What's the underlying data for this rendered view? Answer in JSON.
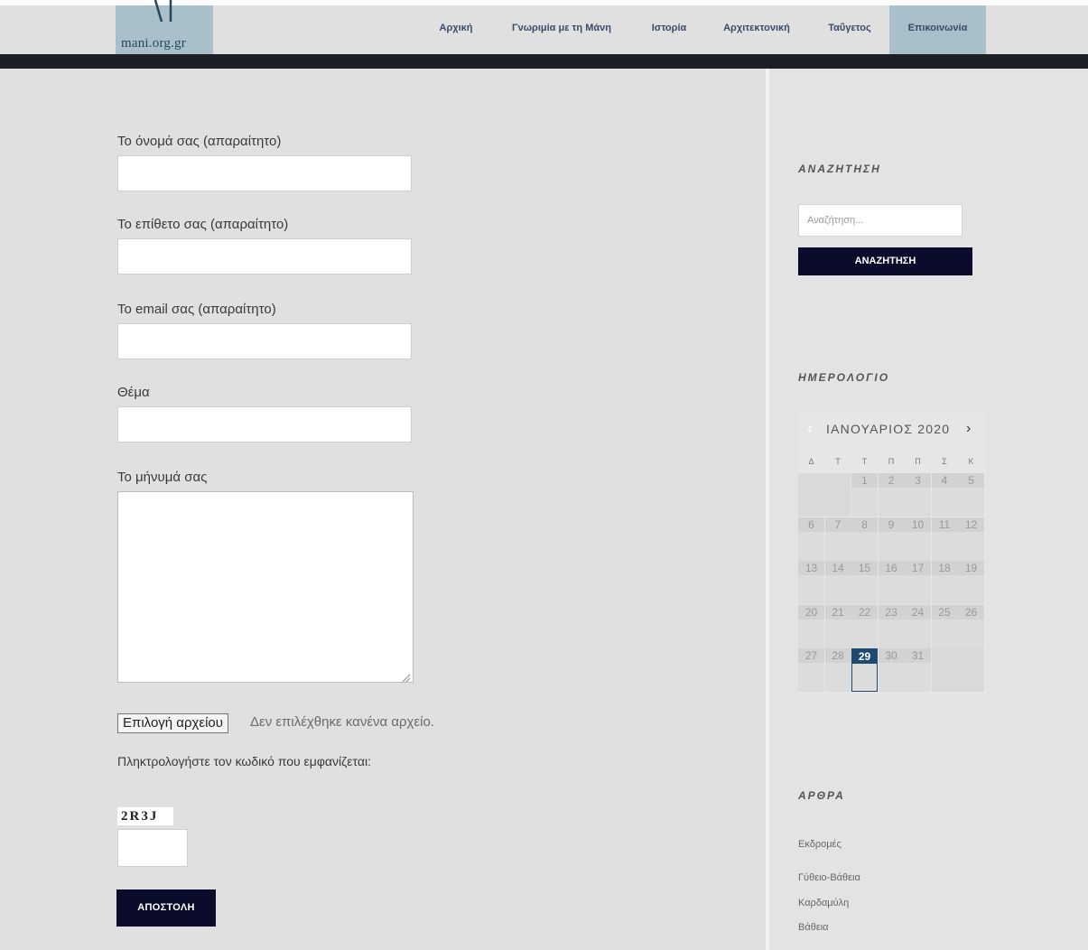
{
  "header": {
    "logo_text": "mani.org.gr",
    "nav": [
      {
        "label": "Αρχική",
        "active": false
      },
      {
        "label": "Γνωριμία με τη Μάνη",
        "active": false
      },
      {
        "label": "Ιστορία",
        "active": false
      },
      {
        "label": "Αρχιτεκτονική",
        "active": false
      },
      {
        "label": "Ταΰγετος",
        "active": false
      },
      {
        "label": "Επικοινωνία",
        "active": true
      }
    ]
  },
  "form": {
    "name_label": "Το όνομά σας (απαραίτητο)",
    "surname_label": "Το επίθετο σας (απαραίτητο)",
    "email_label": "Το email σας (απαραίτητο)",
    "subject_label": "Θέμα",
    "message_label": "Το μήνυμά σας",
    "file_button": "Επιλογή αρχείου",
    "file_status": "Δεν επιλέχθηκε κανένα αρχείο.",
    "captcha_label": "Πληκτρολογήστε τον κωδικό που εμφανίζεται:",
    "captcha_code": "2R3J",
    "submit_label": "ΑΠΟΣΤΟΛΗ"
  },
  "sidebar": {
    "search_title": "ΑΝΑΖΗΤΗΣΗ",
    "search_placeholder": "Αναζήτηση...",
    "search_button": "ΑΝΑΖΗΤΗΣΗ",
    "calendar_title": "ΗΜΕΡΟΛΟΓΙΟ",
    "calendar": {
      "prev_symbol": "‹",
      "next_symbol": "›",
      "month": "ΙΑΝΟΥΑΡΙΟΣ 2020",
      "weekdays": [
        "Δ",
        "Τ",
        "Τ",
        "Π",
        "Π",
        "Σ",
        "Κ"
      ],
      "days": [
        "1",
        "2",
        "3",
        "4",
        "5",
        "6",
        "7",
        "8",
        "9",
        "10",
        "11",
        "12",
        "13",
        "14",
        "15",
        "16",
        "17",
        "18",
        "19",
        "20",
        "21",
        "22",
        "23",
        "24",
        "25",
        "26",
        "27",
        "28",
        "29",
        "30",
        "31"
      ],
      "today": "29"
    },
    "posts_title": "ΑΡΘΡΑ",
    "posts": [
      "Εκδρομές",
      "Γύθειο-Βάθεια",
      "Καρδαμύλη",
      "Βάθεια"
    ]
  },
  "colors": {
    "background": "#e0e0e0",
    "nav_active": "#a9bfca",
    "dark_bar": "#1c1f23",
    "button": "#0b0c2b",
    "today": "#1d4a6e"
  }
}
